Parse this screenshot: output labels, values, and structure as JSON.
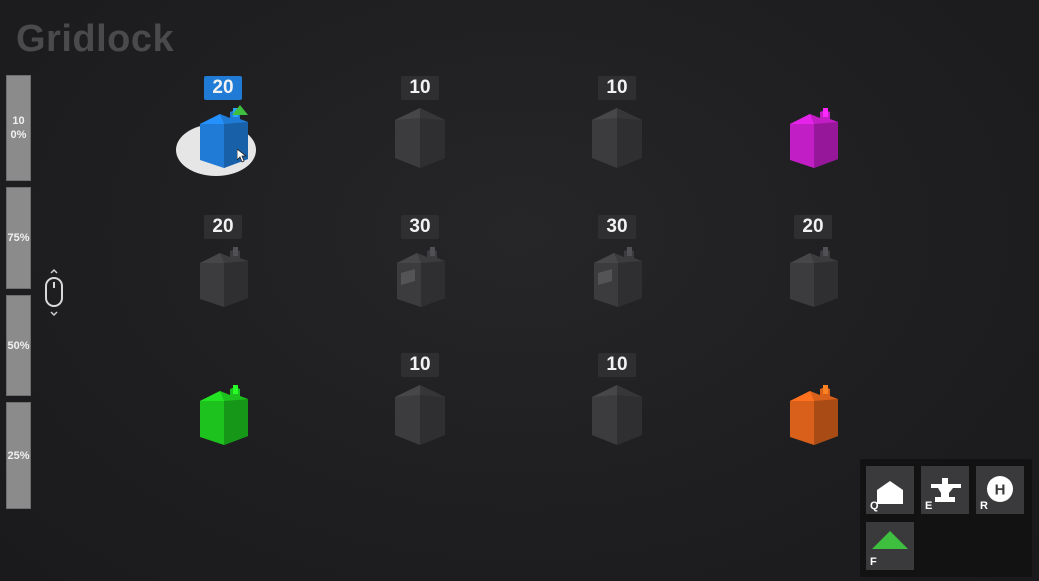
{
  "title": "Gridlock",
  "zoom": {
    "levels": [
      {
        "label": "100%"
      },
      {
        "label": "75%"
      },
      {
        "label": "50%"
      },
      {
        "label": "25%"
      }
    ]
  },
  "colors": {
    "selected": "#1f7bd6",
    "neutral": "#3c3c3f",
    "magenta": "#c21ec6",
    "green": "#1ec21e",
    "orange": "#d9601a"
  },
  "grid": {
    "rows": [
      [
        {
          "value": "20",
          "owner": "blue",
          "selected": true,
          "type": "factory"
        },
        {
          "value": "10",
          "owner": "neutral",
          "type": "house"
        },
        {
          "value": "10",
          "owner": "neutral",
          "type": "house"
        },
        {
          "value": "",
          "owner": "magenta",
          "type": "factory"
        }
      ],
      [
        {
          "value": "20",
          "owner": "neutral",
          "type": "factory"
        },
        {
          "value": "30",
          "owner": "neutral",
          "type": "factory-window"
        },
        {
          "value": "30",
          "owner": "neutral",
          "type": "factory-window"
        },
        {
          "value": "20",
          "owner": "neutral",
          "type": "factory"
        }
      ],
      [
        {
          "value": "",
          "owner": "green",
          "type": "factory"
        },
        {
          "value": "10",
          "owner": "neutral",
          "type": "house"
        },
        {
          "value": "10",
          "owner": "neutral",
          "type": "house"
        },
        {
          "value": "",
          "owner": "orange",
          "type": "factory"
        }
      ]
    ]
  },
  "toolbar": {
    "tools": [
      {
        "key": "Q",
        "icon": "barracks-icon"
      },
      {
        "key": "E",
        "icon": "anvil-icon"
      },
      {
        "key": "R",
        "icon": "helipad-icon"
      },
      {
        "key": "F",
        "icon": "pyramid-icon"
      }
    ]
  }
}
